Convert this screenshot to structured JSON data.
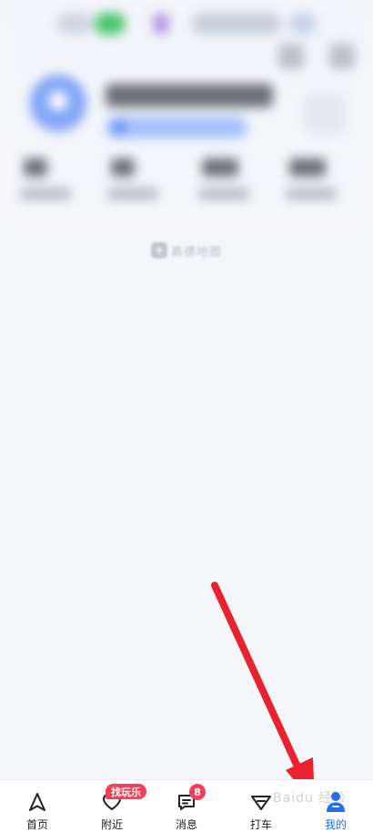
{
  "brand": {
    "logo_glyph": "✈",
    "name": "高德地图"
  },
  "tabs": [
    {
      "id": "home",
      "label": "首页",
      "icon": "navigation-arrow-icon"
    },
    {
      "id": "nearby",
      "label": "附近",
      "icon": "heart-icon",
      "badge": "找玩乐"
    },
    {
      "id": "messages",
      "label": "消息",
      "icon": "chat-bubble-icon",
      "badge_count": "8"
    },
    {
      "id": "taxi",
      "label": "打车",
      "icon": "taxi-flag-icon"
    },
    {
      "id": "mine",
      "label": "我的",
      "icon": "user-profile-icon",
      "active": true
    }
  ],
  "colors": {
    "active": "#1f6ff0",
    "badge": "#f0415a",
    "annotation_arrow": "#e8232f"
  },
  "watermark": "Baidu 经验"
}
